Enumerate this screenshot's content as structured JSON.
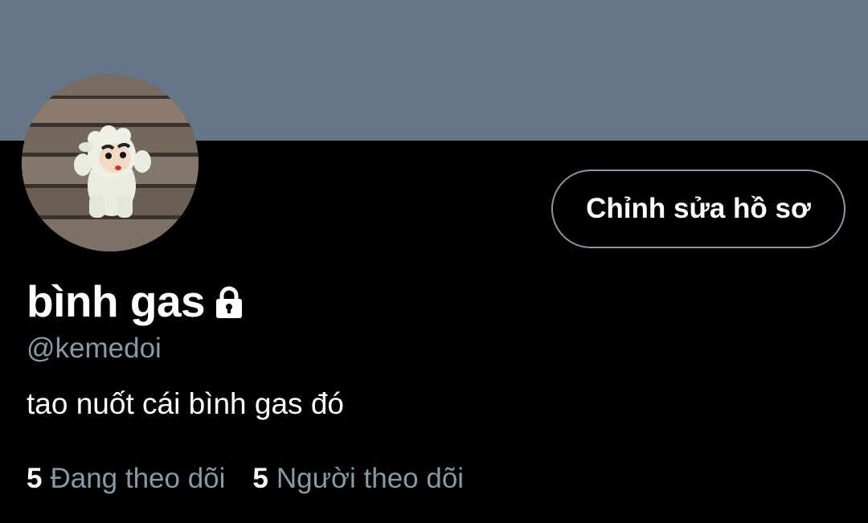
{
  "profile": {
    "banner_color": "#657786",
    "display_name": "bình gas",
    "protected_icon": "lock-icon",
    "handle": "@kemedoi",
    "bio": "tao nuốt cái bình gas đó",
    "avatar": "avatar-cartoon-sheep-costume"
  },
  "actions": {
    "edit_profile_label": "Chỉnh sửa hồ sơ"
  },
  "stats": {
    "following": {
      "count": "5",
      "label": "Đang theo dõi"
    },
    "followers": {
      "count": "5",
      "label": "Người theo dõi"
    }
  },
  "colors": {
    "background": "#000000",
    "primary_text": "#ffffff",
    "secondary_text": "#8899a6",
    "button_border": "#8899a6"
  }
}
